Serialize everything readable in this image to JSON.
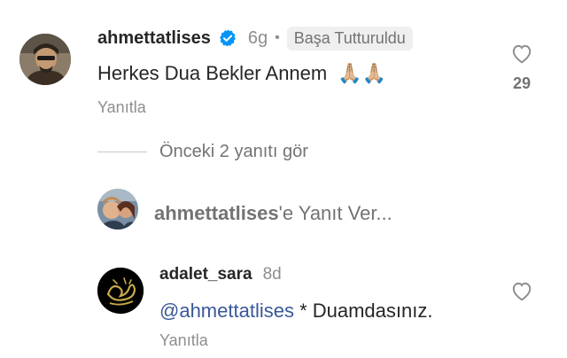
{
  "pinned_comment": {
    "username": "ahmettatlises",
    "time": "6g",
    "separator": "•",
    "pinned_label": "Başa Tutturuldu",
    "text": "Herkes Dua Bekler Annem",
    "emoji": "🙏🏼🙏🏼",
    "reply_label": "Yanıtla",
    "like_count": "29",
    "icon_like": "heart-outline-icon",
    "verified_icon": "verified-badge-icon",
    "verified_color": "#0095f6"
  },
  "view_previous_replies": "Önceki 2 yanıtı gör",
  "reply_composer": {
    "target_username": "ahmettatlises",
    "prompt_suffix": "'e Yanıt Ver..."
  },
  "reply_comment": {
    "username": "adalet_sara",
    "time": "8d",
    "mention": "@ahmettatlises",
    "text": " * Duamdasınız.",
    "reply_label": "Yanıtla",
    "icon_like": "heart-outline-icon"
  }
}
